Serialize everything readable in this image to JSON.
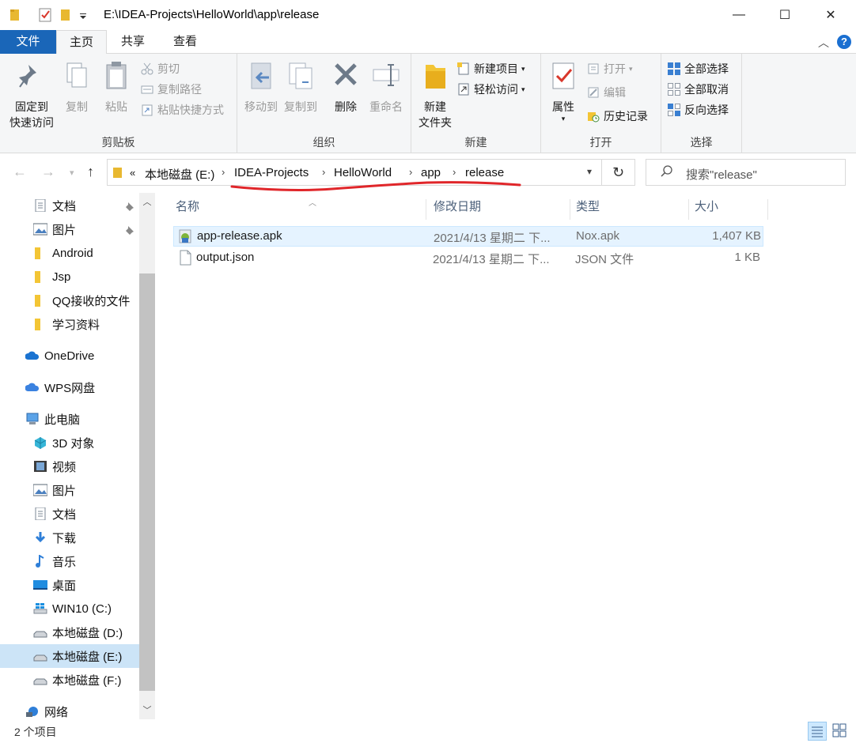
{
  "window": {
    "title": "E:\\IDEA-Projects\\HelloWorld\\app\\release",
    "minimize_glyph": "—",
    "maximize_glyph": "☐",
    "close_glyph": "✕"
  },
  "tabs": {
    "file": "文件",
    "home": "主页",
    "share": "共享",
    "view": "查看",
    "collapse_glyph": "︿",
    "help_glyph": "?"
  },
  "ribbon": {
    "clipboard": {
      "label": "剪贴板",
      "pin_label_line1": "固定到",
      "pin_label_line2": "快速访问",
      "copy": "复制",
      "paste": "粘贴",
      "cut": "剪切",
      "copy_path": "复制路径",
      "paste_shortcut": "粘贴快捷方式"
    },
    "organize": {
      "label": "组织",
      "move_to": "移动到",
      "copy_to": "复制到",
      "delete": "删除",
      "rename": "重命名"
    },
    "new": {
      "label": "新建",
      "new_folder_line1": "新建",
      "new_folder_line2": "文件夹",
      "new_item": "新建项目",
      "easy_access": "轻松访问"
    },
    "open": {
      "label": "打开",
      "properties": "属性",
      "open": "打开",
      "edit": "编辑",
      "history": "历史记录"
    },
    "select": {
      "label": "选择",
      "select_all": "全部选择",
      "select_none": "全部取消",
      "invert": "反向选择"
    }
  },
  "address": {
    "overflow": "«",
    "crumbs": [
      "本地磁盘 (E:)",
      "IDEA-Projects",
      "HelloWorld",
      "app",
      "release"
    ],
    "search_placeholder": "搜索\"release\""
  },
  "nav": {
    "items": [
      {
        "label": "文档",
        "icon": "document-icon",
        "pinned": true
      },
      {
        "label": "图片",
        "icon": "picture-icon",
        "pinned": true
      },
      {
        "label": "Android",
        "icon": "folder-icon"
      },
      {
        "label": "Jsp",
        "icon": "folder-icon"
      },
      {
        "label": "QQ接收的文件",
        "icon": "folder-icon"
      },
      {
        "label": "学习资料",
        "icon": "folder-icon"
      },
      {
        "label": "OneDrive",
        "icon": "onedrive-icon"
      },
      {
        "label": "WPS网盘",
        "icon": "wps-cloud-icon"
      },
      {
        "label": "此电脑",
        "icon": "this-pc-icon"
      },
      {
        "label": "3D 对象",
        "icon": "3d-objects-icon"
      },
      {
        "label": "视频",
        "icon": "video-icon"
      },
      {
        "label": "图片",
        "icon": "picture-icon"
      },
      {
        "label": "文档",
        "icon": "document-icon"
      },
      {
        "label": "下载",
        "icon": "download-icon"
      },
      {
        "label": "音乐",
        "icon": "music-icon"
      },
      {
        "label": "桌面",
        "icon": "desktop-icon"
      },
      {
        "label": "WIN10 (C:)",
        "icon": "windows-drive-icon"
      },
      {
        "label": "本地磁盘 (D:)",
        "icon": "drive-icon"
      },
      {
        "label": "本地磁盘 (E:)",
        "icon": "drive-icon",
        "selected": true
      },
      {
        "label": "本地磁盘 (F:)",
        "icon": "drive-icon"
      },
      {
        "label": "网络",
        "icon": "network-icon"
      }
    ]
  },
  "files": {
    "columns": [
      "名称",
      "修改日期",
      "类型",
      "大小"
    ],
    "rows": [
      {
        "name": "app-release.apk",
        "date": "2021/4/13 星期二 下...",
        "type": "Nox.apk",
        "size": "1,407 KB",
        "icon": "apk-icon"
      },
      {
        "name": "output.json",
        "date": "2021/4/13 星期二 下...",
        "type": "JSON 文件",
        "size": "1 KB",
        "icon": "json-file-icon"
      }
    ]
  },
  "status": {
    "count": "2 个项目"
  },
  "colors": {
    "accent": "#1a66b8",
    "annotation": "#e0262a",
    "selection": "#cce4f7"
  }
}
